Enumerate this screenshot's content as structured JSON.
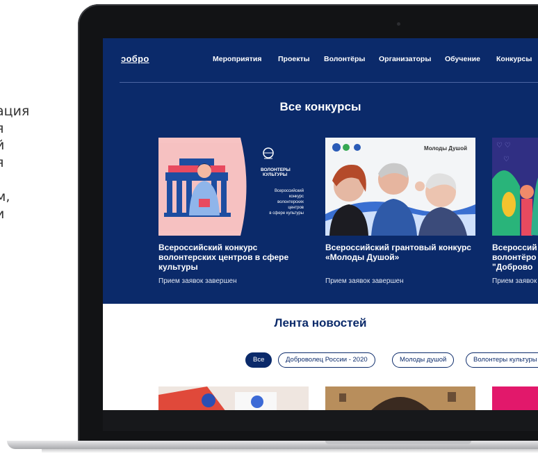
{
  "side_text": {
    "lines": [
      "ация",
      "я",
      "й",
      "я",
      "",
      "м,",
      "и"
    ]
  },
  "site": {
    "logo": "ↄобро",
    "nav": [
      "Мероприятия",
      "Проекты",
      "Волонтёры",
      "Организаторы",
      "Обучение",
      "Конкурсы"
    ]
  },
  "contests": {
    "title": "Все конкурсы",
    "cards": [
      {
        "title": "Всероссийский конкурс волонтерских центров в сфере культуры",
        "status": "Прием заявок завершен",
        "image_logo_text": "ВОЛОНТЕРЫ\nКУЛЬТУРЫ",
        "image_text": "Всероссийский конкурс волонтерских центров в сфере культуры"
      },
      {
        "title": "Всероссийский грантовый конкурс «Молоды Душой»",
        "status": "Прием заявок завершен",
        "image_brand": "Молоды Душой"
      },
      {
        "title": "Всероссий волонтёро \"Доброво",
        "status": "Прием заявок"
      }
    ]
  },
  "news": {
    "title": "Лента новостей",
    "chips": [
      "Все",
      "Доброволец России - 2020",
      "Молоды душой",
      "Волонтеры культуры"
    ]
  },
  "colors": {
    "brand_navy": "#0b2a6a",
    "pink_card_bg": "#f5c6c6",
    "accent_red": "#e84a5f"
  }
}
